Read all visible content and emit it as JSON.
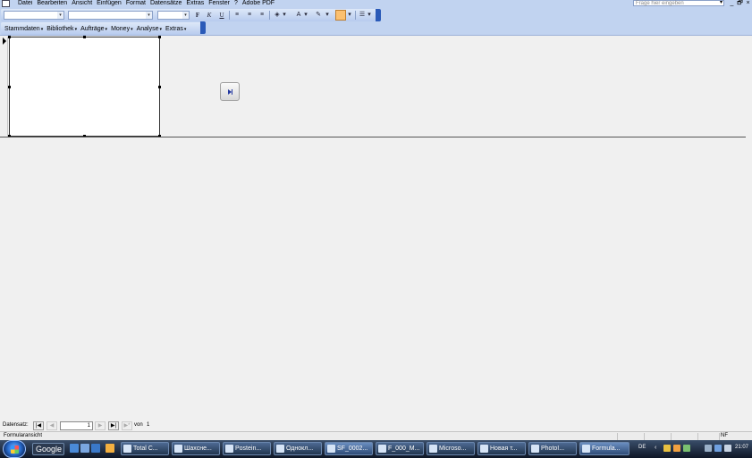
{
  "menubar": {
    "items": [
      "Datei",
      "Bearbeiten",
      "Ansicht",
      "Einfügen",
      "Format",
      "Datensätze",
      "Extras",
      "Fenster",
      "?",
      "Adobe PDF"
    ],
    "help_placeholder": "Frage hier eingeben",
    "window_controls": [
      "_",
      "🗗",
      "×"
    ]
  },
  "format_toolbar": {
    "bold": "F",
    "italic": "K",
    "underline": "U",
    "font_color_letter": "A"
  },
  "custom_toolbar": {
    "items": [
      "Stammdaten",
      "Bibliothek",
      "Aufträge",
      "Money",
      "Analyse",
      "Extras"
    ]
  },
  "navigation": {
    "label": "Datensatz:",
    "first": "|◀",
    "prev": "◀",
    "current": "1",
    "next": "▶",
    "last": "▶|",
    "new": "▶*",
    "of_label": "von",
    "total": "1"
  },
  "statusbar": {
    "text": "Formularansicht",
    "indicator": "NF"
  },
  "taskbar": {
    "search_label": "Google",
    "tasks": [
      "Total C...",
      "Шахсне...",
      "Postein...",
      "Однокл...",
      "SF_0002...",
      "F_000_M...",
      "Microso...",
      "Новая т...",
      "PhotoI...",
      "Formula..."
    ],
    "language": "DE",
    "clock": "21:07"
  },
  "colors": {
    "toolbar_bg": "#c1d3f0",
    "taskbar_bg": "#1a2638",
    "highlight_button": "#fbc070"
  }
}
